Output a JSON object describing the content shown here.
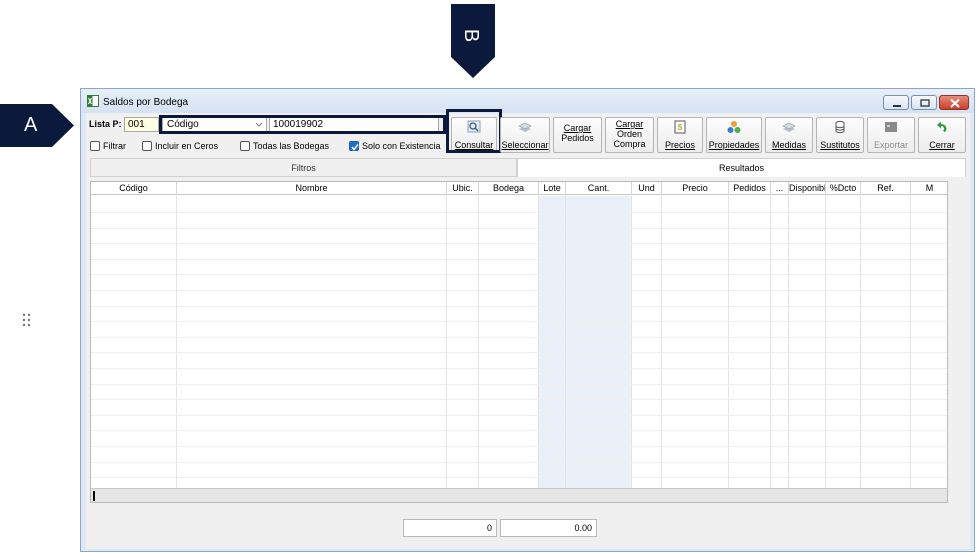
{
  "markers": {
    "a": "A",
    "b": "B"
  },
  "window": {
    "title": "Saldos por Bodega"
  },
  "filters": {
    "lista_label": "Lista P:",
    "lista_value": "001",
    "field_select": "Código",
    "search_value": "100019902",
    "checkboxes": [
      {
        "label": "Filtrar",
        "checked": false
      },
      {
        "label": "Incluir en Ceros",
        "checked": false
      },
      {
        "label": "Todas las Bodegas",
        "checked": false
      },
      {
        "label": "Solo con Existencia",
        "checked": true
      }
    ]
  },
  "toolbar": {
    "consultar": "Consultar",
    "seleccionar": "Seleccionar",
    "cargar_pedidos_1": "Cargar",
    "cargar_pedidos_2": "Pedidos",
    "cargar_orden_1": "Cargar",
    "cargar_orden_2": "Orden",
    "cargar_orden_3": "Compra",
    "precios": "Precios",
    "propiedades": "Propiedades",
    "medidas": "Medidas",
    "sustitutos": "Sustitutos",
    "exportar": "Exportar",
    "cerrar": "Cerrar"
  },
  "tabs": {
    "filtros": "Filtros",
    "resultados": "Resultados"
  },
  "grid": {
    "columns": [
      "Código",
      "Nombre",
      "Ubic.",
      "Bodega",
      "Lote",
      "Cant.",
      "Und",
      "Precio",
      "Pedidos",
      "...",
      "Disponibl",
      "%Dcto",
      "Ref.",
      "M"
    ]
  },
  "totals": {
    "quantity": "0",
    "amount": "0.00"
  },
  "colors": {
    "marker": "#0b1a3c",
    "accent": "#1f6fd1"
  }
}
